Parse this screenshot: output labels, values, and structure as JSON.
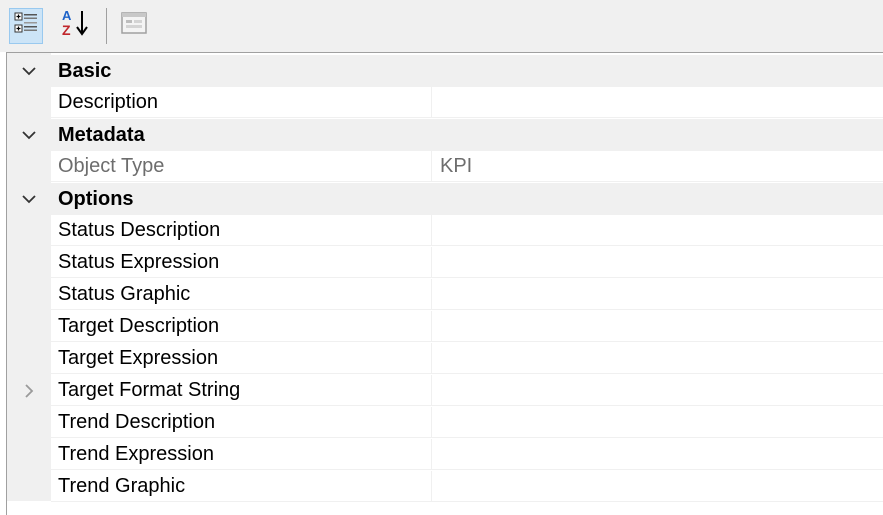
{
  "toolbar": {
    "buttons": [
      {
        "id": "categorized",
        "icon": "categorized-view-icon",
        "active": true
      },
      {
        "id": "alphabetical",
        "icon": "sort-az-icon",
        "active": false
      },
      {
        "id": "property-pages",
        "icon": "property-pages-icon",
        "active": false
      }
    ]
  },
  "grid": {
    "categories": [
      {
        "label": "Basic",
        "expanded": true,
        "properties": [
          {
            "name": "Description",
            "value": ""
          }
        ]
      },
      {
        "label": "Metadata",
        "expanded": true,
        "properties": [
          {
            "name": "Object Type",
            "value": "KPI",
            "readonly": true
          }
        ]
      },
      {
        "label": "Options",
        "expanded": true,
        "properties": [
          {
            "name": "Status Description",
            "value": ""
          },
          {
            "name": "Status Expression",
            "value": ""
          },
          {
            "name": "Status Graphic",
            "value": ""
          },
          {
            "name": "Target Description",
            "value": ""
          },
          {
            "name": "Target Expression",
            "value": ""
          },
          {
            "name": "Target Format String",
            "value": "",
            "expandable": true
          },
          {
            "name": "Trend Description",
            "value": ""
          },
          {
            "name": "Trend Expression",
            "value": ""
          },
          {
            "name": "Trend Graphic",
            "value": ""
          }
        ]
      }
    ]
  },
  "colors": {
    "toolbar_bg": "#f0f0f0",
    "gutter_bg": "#f0f0f0",
    "active_button": "#cce4f7",
    "readonly_text": "#6d6d6d"
  }
}
